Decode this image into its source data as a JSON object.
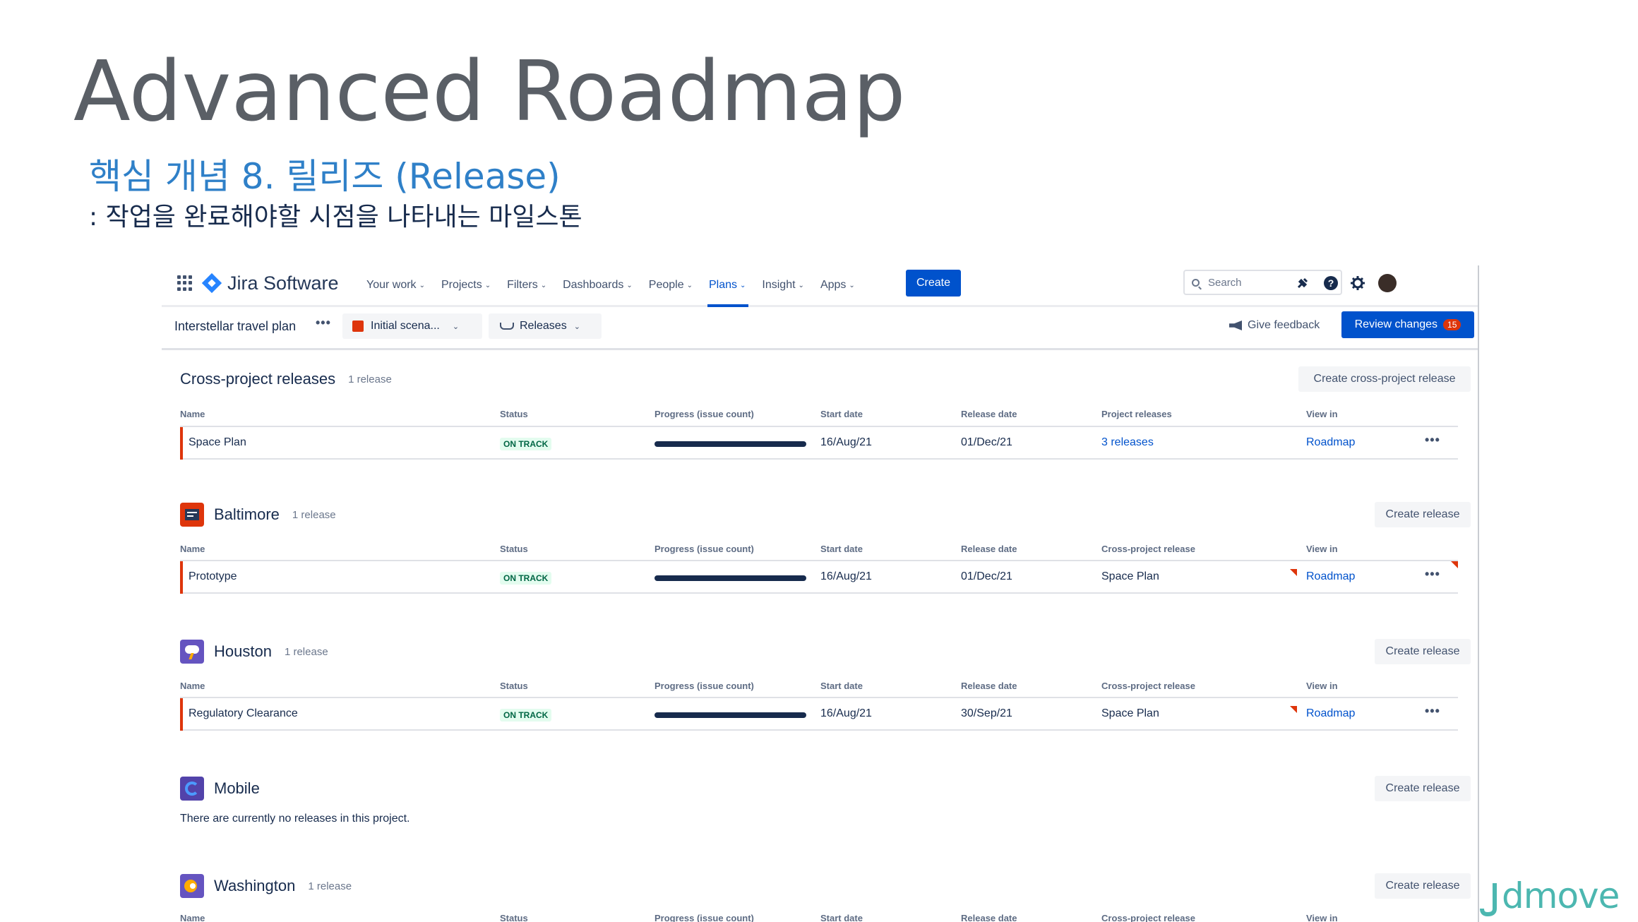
{
  "slide": {
    "title": "Advanced Roadmap",
    "subtitle": "핵심 개념 8. 릴리즈 (Release)",
    "description": ": 작업을 완료해야할 시점을 나타내는 마일스톤",
    "watermark": "dmove"
  },
  "topnav": {
    "logo": "Jira Software",
    "items": [
      "Your work",
      "Projects",
      "Filters",
      "Dashboards",
      "People",
      "Plans",
      "Insight",
      "Apps"
    ],
    "active": "Plans",
    "create": "Create",
    "search_placeholder": "Search"
  },
  "subbar": {
    "plan_name": "Interstellar travel plan",
    "scenario": "Initial scena...",
    "releases": "Releases",
    "feedback": "Give feedback",
    "review": "Review changes",
    "review_count": "15"
  },
  "colors": {
    "accent": "#0052cc",
    "status_bg": "#e3fcef",
    "status_fg": "#006644",
    "bar": "#de350b"
  },
  "cross_project": {
    "title": "Cross-project releases",
    "count": "1 release",
    "button": "Create cross-project release",
    "columns": [
      "Name",
      "Status",
      "Progress (issue count)",
      "Start date",
      "Release date",
      "Project releases",
      "View in"
    ],
    "rows": [
      {
        "name": "Space Plan",
        "status": "ON TRACK",
        "start": "16/Aug/21",
        "release": "01/Dec/21",
        "project_releases": "3 releases",
        "view": "Roadmap"
      }
    ]
  },
  "projects": [
    {
      "title": "Baltimore",
      "count": "1 release",
      "button": "Create release",
      "columns": [
        "Name",
        "Status",
        "Progress (issue count)",
        "Start date",
        "Release date",
        "Cross-project release",
        "View in"
      ],
      "row": {
        "name": "Prototype",
        "status": "ON TRACK",
        "start": "16/Aug/21",
        "release": "01/Dec/21",
        "cross": "Space Plan",
        "view": "Roadmap"
      }
    },
    {
      "title": "Houston",
      "count": "1 release",
      "button": "Create release",
      "columns": [
        "Name",
        "Status",
        "Progress (issue count)",
        "Start date",
        "Release date",
        "Cross-project release",
        "View in"
      ],
      "row": {
        "name": "Regulatory Clearance",
        "status": "ON TRACK",
        "start": "16/Aug/21",
        "release": "30/Sep/21",
        "cross": "Space Plan",
        "view": "Roadmap"
      }
    },
    {
      "title": "Mobile",
      "button": "Create release",
      "empty": "There are currently no releases in this project."
    },
    {
      "title": "Washington",
      "count": "1 release",
      "button": "Create release",
      "columns": [
        "Name",
        "Status",
        "Progress (issue count)",
        "Start date",
        "Release date",
        "Cross-project release",
        "View in"
      ]
    }
  ]
}
